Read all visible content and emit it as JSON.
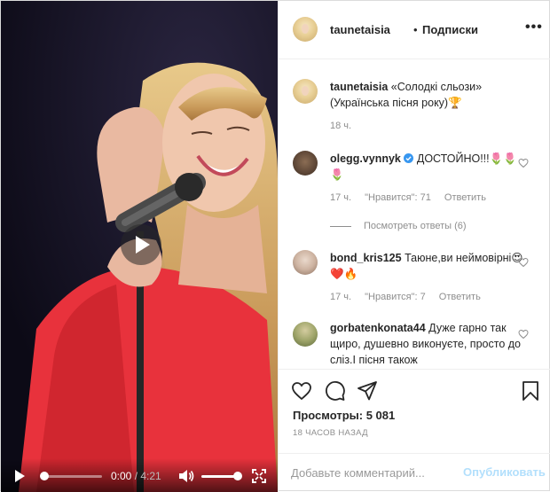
{
  "video": {
    "current_time": "0:00",
    "duration": "/ 4:21",
    "progress": 0.0,
    "volume": 0.9
  },
  "header": {
    "username": "taunetaisia",
    "separator": "•",
    "follow_label": "Подписки",
    "more_label": "•••"
  },
  "caption": {
    "username": "taunetaisia",
    "text": "«Солодкі сльози» (Українська пісня року)🏆",
    "time": "18 ч."
  },
  "comments": [
    {
      "username": "olegg.vynnyk",
      "verified": true,
      "text": "ДОСТОЙНО!!!🌷🌷🌷",
      "time": "17 ч.",
      "likes": "\"Нравится\": 71",
      "reply_label": "Ответить"
    },
    {
      "username": "bond_kris125",
      "text": "Таюне,ви неймовірні😍❤️🔥",
      "time": "17 ч.",
      "likes": "\"Нравится\": 7",
      "reply_label": "Ответить"
    },
    {
      "username": "gorbatenkonata44",
      "text": "Дуже гарно так щиро, душевно виконуєте, просто до сліз.І пісня також"
    }
  ],
  "view_replies": "Посмотреть ответы (6)",
  "stats": {
    "views_label": "Просмотры:",
    "views_value": "5 081",
    "posted": "18 ЧАСОВ НАЗАД"
  },
  "add_comment": {
    "placeholder": "Добавьте комментарий...",
    "publish_label": "Опубликовать"
  },
  "colors": {
    "accent_disabled": "#b2dffc",
    "verified": "#3897f0",
    "muted": "#8e8e8e",
    "dress": "#e8323c"
  },
  "icons": [
    "heart-icon",
    "comment-icon",
    "share-icon",
    "bookmark-icon",
    "play-icon",
    "volume-icon",
    "fullscreen-icon",
    "more-icon",
    "verified-icon"
  ]
}
